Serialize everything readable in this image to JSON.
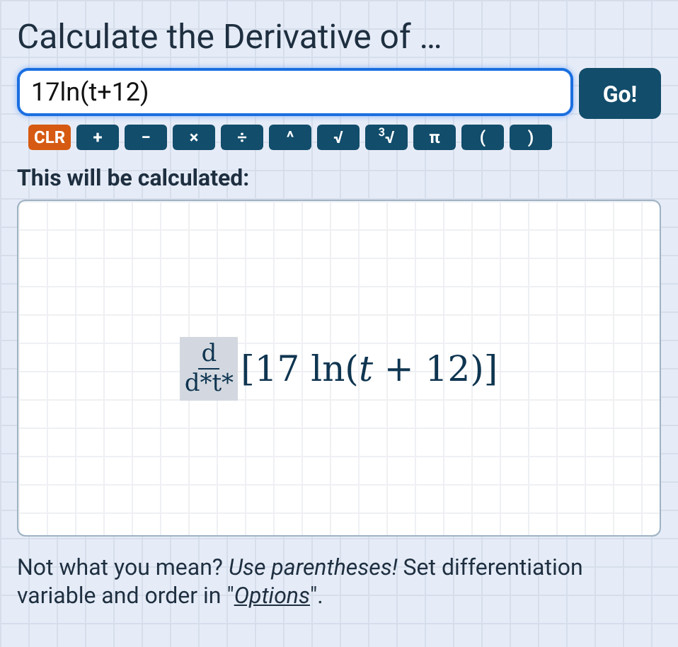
{
  "title": "Calculate the Derivative of …",
  "input": {
    "value": "17ln(t+12)"
  },
  "go_button": "Go!",
  "keys": [
    {
      "label": "CLR",
      "kind": "clear"
    },
    {
      "label": "+",
      "kind": "key"
    },
    {
      "label": "−",
      "kind": "key"
    },
    {
      "label": "×",
      "kind": "key"
    },
    {
      "label": "÷",
      "kind": "key"
    },
    {
      "label": "^",
      "kind": "key"
    },
    {
      "label": "√",
      "kind": "key"
    },
    {
      "label": "$^{3}$√",
      "kind": "key"
    },
    {
      "label": "π",
      "kind": "key"
    },
    {
      "label": "(",
      "kind": "key"
    },
    {
      "label": ")",
      "kind": "key"
    }
  ],
  "preview": {
    "heading": "This will be calculated:",
    "numerator": "d",
    "denominator": "d*t*",
    "expression": "[17 ln(*t* + 12)]"
  },
  "note": {
    "before": "Not what you mean? *Use parentheses!* Set differentiation variable and order in \"",
    "link": "Options",
    "after": "\"."
  }
}
